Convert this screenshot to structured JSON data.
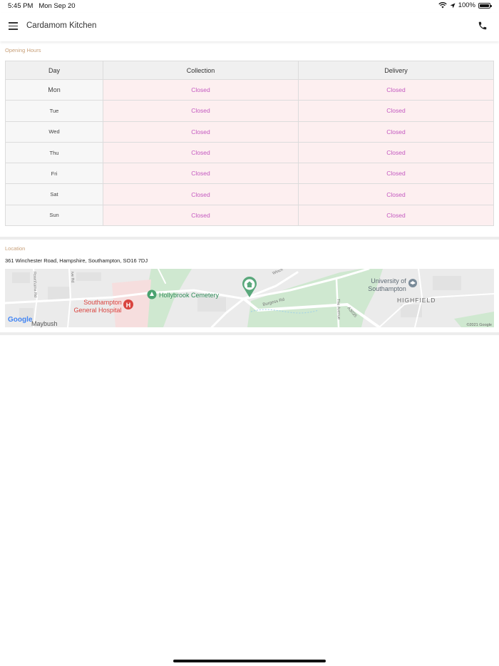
{
  "status_bar": {
    "time": "5:45 PM",
    "date": "Mon Sep 20",
    "battery": "100%"
  },
  "app_bar": {
    "title": "Cardamom Kitchen",
    "menu_icon": "hamburger-menu-icon",
    "call_icon": "phone-icon"
  },
  "opening_hours": {
    "label": "Opening Hours",
    "headers": [
      "Day",
      "Collection",
      "Delivery"
    ],
    "rows": [
      {
        "day": "Mon",
        "collection": "Closed",
        "delivery": "Closed"
      },
      {
        "day": "Tue",
        "collection": "Closed",
        "delivery": "Closed"
      },
      {
        "day": "Wed",
        "collection": "Closed",
        "delivery": "Closed"
      },
      {
        "day": "Thu",
        "collection": "Closed",
        "delivery": "Closed"
      },
      {
        "day": "Fri",
        "collection": "Closed",
        "delivery": "Closed"
      },
      {
        "day": "Sat",
        "collection": "Closed",
        "delivery": "Closed"
      },
      {
        "day": "Sun",
        "collection": "Closed",
        "delivery": "Closed"
      }
    ]
  },
  "location": {
    "label": "Location",
    "address": "361 Winchester Road, Hampshire, Southampton, SO16 7DJ",
    "map": {
      "labels": {
        "hospital": "Southampton General Hospital",
        "hospital_line1": "Southampton",
        "hospital_line2": "General Hospital",
        "cemetery": "Hollybrook Cemetery",
        "university_line1": "University of",
        "university_line2": "Southampton",
        "district": "HIGHFIELD",
        "area": "Maybush",
        "road_burgess": "Burgess Rd",
        "road_avenue": "The Avenue",
        "road_a35": "A3035",
        "road_rownhams": "Rownhams Rd",
        "road_winch": "Winch",
        "road_partial_rd": "ive Rd",
        "logo": "Google",
        "copyright": "©2021 Google"
      },
      "colors": {
        "park": "#c8e6c9",
        "road": "#ffffff",
        "pin": "#5aa87c",
        "hospital": "#d9443f"
      }
    }
  },
  "colors": {
    "accent_label": "#c8a07a",
    "closed_text": "#c45ac0",
    "closed_bg": "#fdeff0"
  }
}
